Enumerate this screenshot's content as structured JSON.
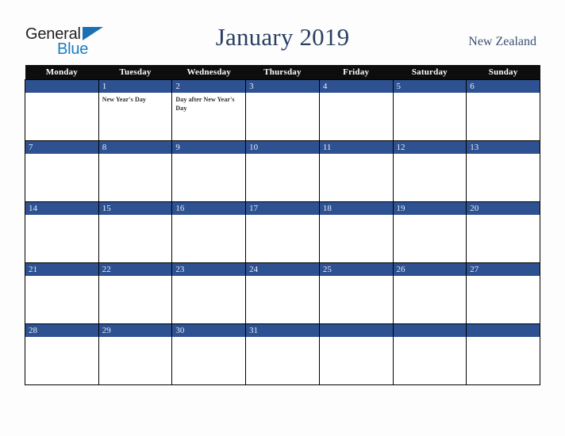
{
  "brand": {
    "name_part1": "General",
    "name_part2": "Blue",
    "color_dark": "#231f20",
    "color_blue": "#1b7dc4"
  },
  "header": {
    "title": "January 2019",
    "country": "New Zealand",
    "title_color": "#2a3f63",
    "country_color": "#3a4f75"
  },
  "calendar": {
    "month": "January",
    "year": "2019",
    "header_bg": "#0d0d0d",
    "daybar_bg": "#2d5191",
    "weekday_headers": [
      "Monday",
      "Tuesday",
      "Wednesday",
      "Thursday",
      "Friday",
      "Saturday",
      "Sunday"
    ],
    "weeks": [
      [
        {
          "date": "",
          "events": []
        },
        {
          "date": "1",
          "events": [
            "New Year's Day"
          ]
        },
        {
          "date": "2",
          "events": [
            "Day after New Year's Day"
          ]
        },
        {
          "date": "3",
          "events": []
        },
        {
          "date": "4",
          "events": []
        },
        {
          "date": "5",
          "events": []
        },
        {
          "date": "6",
          "events": []
        }
      ],
      [
        {
          "date": "7",
          "events": []
        },
        {
          "date": "8",
          "events": []
        },
        {
          "date": "9",
          "events": []
        },
        {
          "date": "10",
          "events": []
        },
        {
          "date": "11",
          "events": []
        },
        {
          "date": "12",
          "events": []
        },
        {
          "date": "13",
          "events": []
        }
      ],
      [
        {
          "date": "14",
          "events": []
        },
        {
          "date": "15",
          "events": []
        },
        {
          "date": "16",
          "events": []
        },
        {
          "date": "17",
          "events": []
        },
        {
          "date": "18",
          "events": []
        },
        {
          "date": "19",
          "events": []
        },
        {
          "date": "20",
          "events": []
        }
      ],
      [
        {
          "date": "21",
          "events": []
        },
        {
          "date": "22",
          "events": []
        },
        {
          "date": "23",
          "events": []
        },
        {
          "date": "24",
          "events": []
        },
        {
          "date": "25",
          "events": []
        },
        {
          "date": "26",
          "events": []
        },
        {
          "date": "27",
          "events": []
        }
      ],
      [
        {
          "date": "28",
          "events": []
        },
        {
          "date": "29",
          "events": []
        },
        {
          "date": "30",
          "events": []
        },
        {
          "date": "31",
          "events": []
        },
        {
          "date": "",
          "events": []
        },
        {
          "date": "",
          "events": []
        },
        {
          "date": "",
          "events": []
        }
      ]
    ]
  }
}
